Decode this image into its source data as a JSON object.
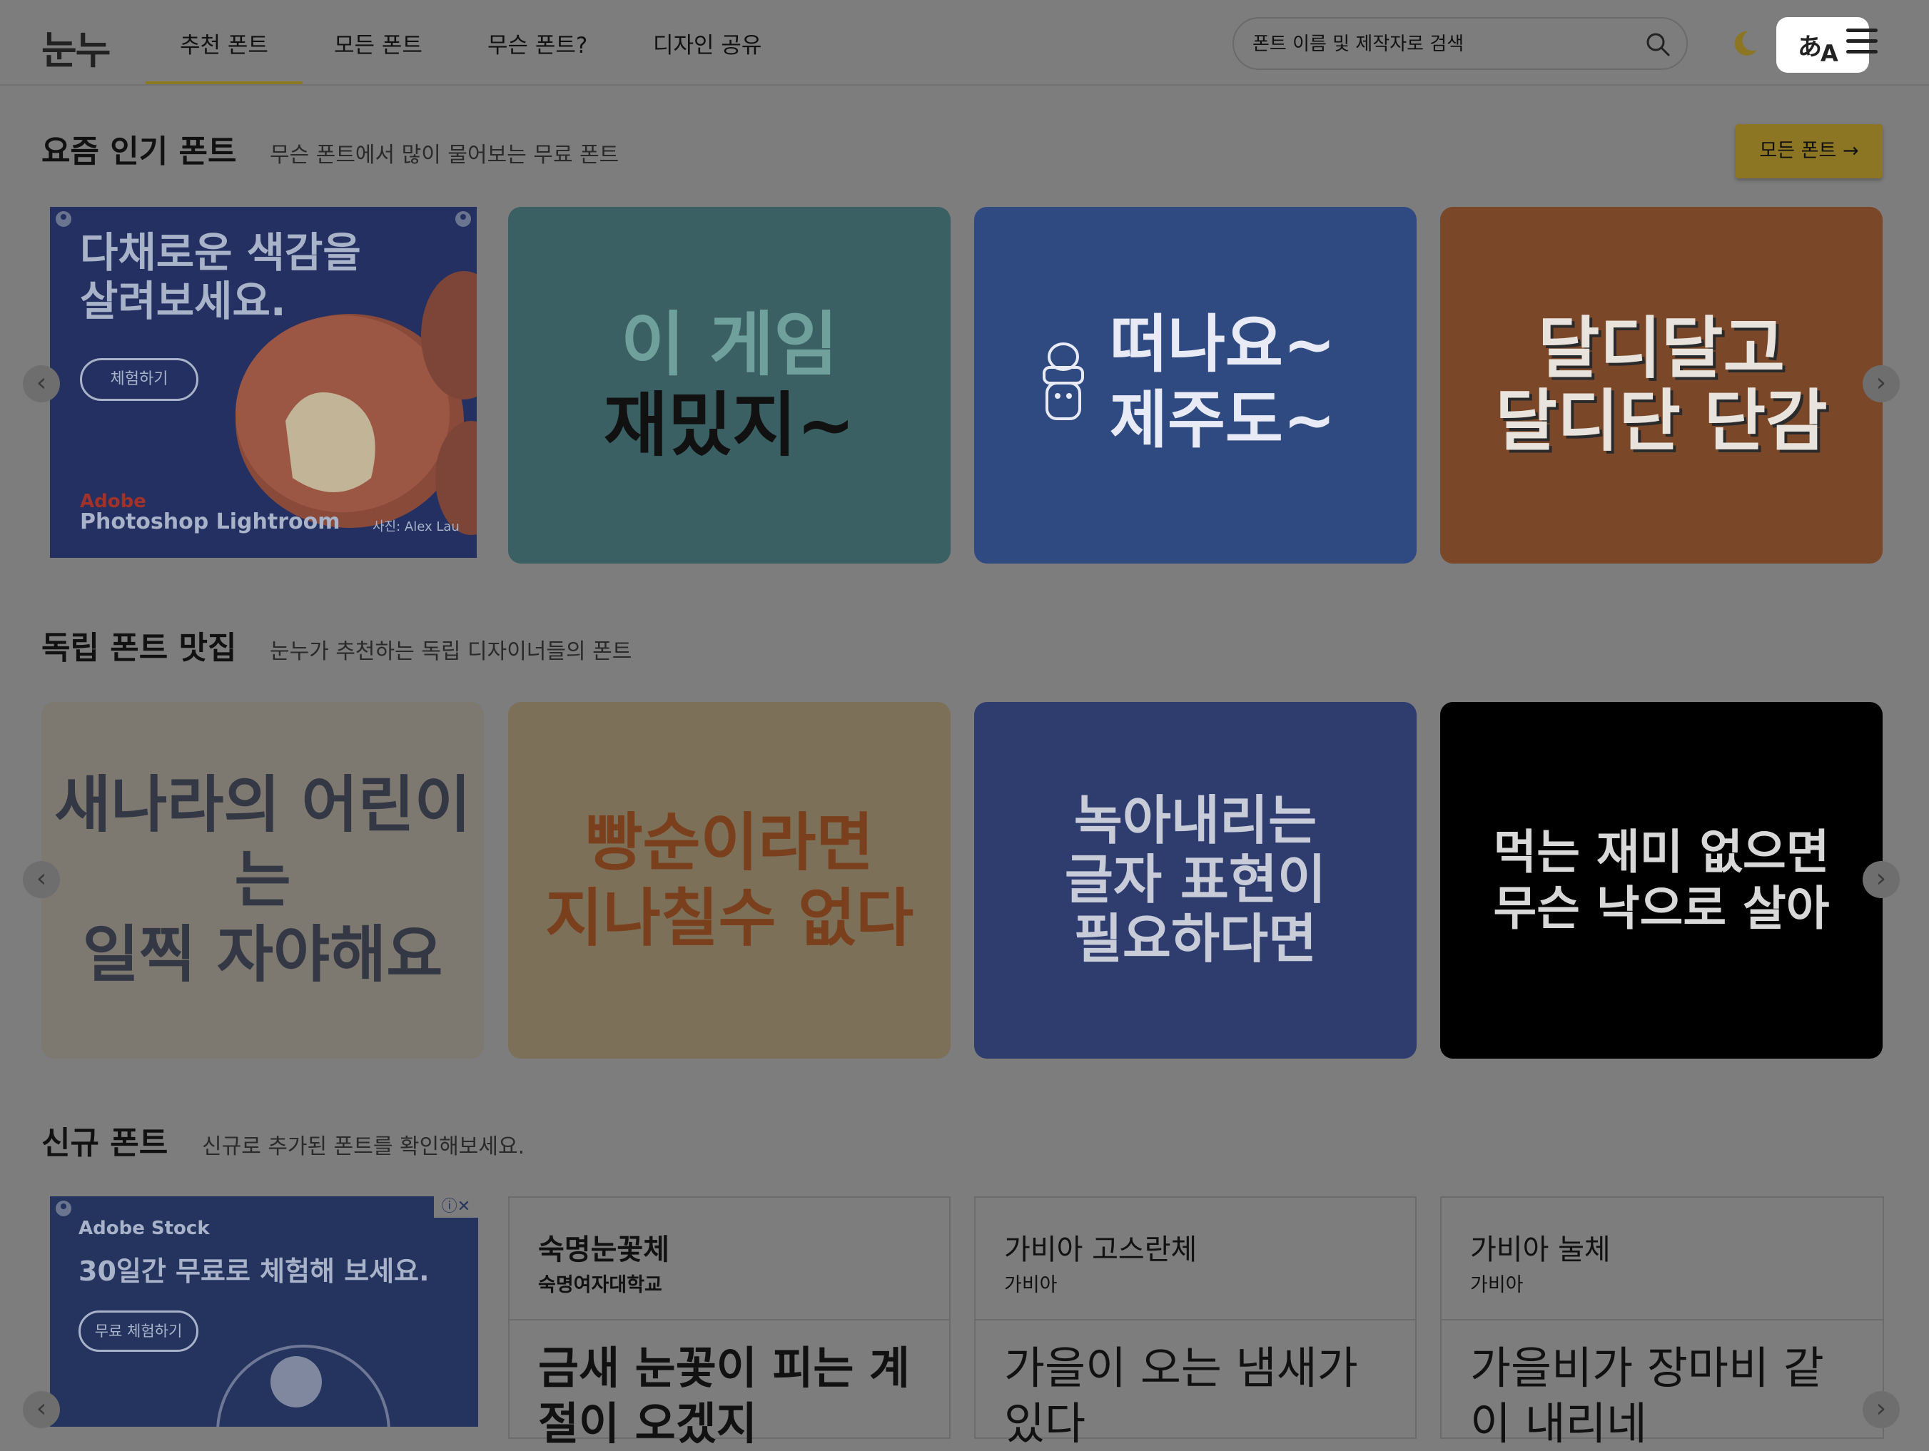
{
  "header": {
    "logo": "눈누",
    "tabs": [
      {
        "label": "추천 폰트",
        "active": true
      },
      {
        "label": "모든 폰트",
        "active": false
      },
      {
        "label": "무슨 폰트?",
        "active": false
      },
      {
        "label": "디자인 공유",
        "active": false
      }
    ],
    "search_placeholder": "폰트 이름 및 제작자로 검색",
    "translate_glyph_1": "あ",
    "translate_glyph_2": "A"
  },
  "popular": {
    "title": "요즘 인기 폰트",
    "subtitle": "무슨 폰트에서 많이 물어보는 무료 폰트",
    "all_button": "모든 폰트 →",
    "ad": {
      "headline_1": "다채로운 색감을",
      "headline_2": "살려보세요.",
      "cta": "체험하기",
      "brand": "Adobe",
      "product": "Photoshop Lightroom",
      "credit": "사진: Alex Lau"
    },
    "cards": [
      {
        "line1": "이 게임",
        "line2": "재밌지~",
        "bg": "#3b6064",
        "color": "#6fa09b"
      },
      {
        "line1": "떠나요~",
        "line2": "제주도~",
        "bg": "#2f4a80",
        "color": "#e8ebf5"
      },
      {
        "line1": "달디달고",
        "line2": "달디단 단감",
        "bg": "#7a4828",
        "color": "#e8e3dc"
      }
    ]
  },
  "indie": {
    "title": "독립 폰트 맛집",
    "subtitle": "눈누가 추천하는 독립 디자이너들의 폰트",
    "cards": [
      {
        "line1": "새나라의 어린이는",
        "line2": "일찍 자야해요",
        "line3": "",
        "bg": "#7d7870",
        "color": "#333844"
      },
      {
        "line1": "빵순이라면",
        "line2": "지나칠수 없다",
        "line3": "",
        "bg": "#7d7058",
        "color": "#7a3f1c"
      },
      {
        "line1": "녹아내리는",
        "line2": "글자 표현이",
        "line3": "필요하다면",
        "bg": "#2e3c6e",
        "color": "#c8ccd8"
      },
      {
        "line1": "먹는 재미 없으면",
        "line2": "무슨 낙으로 살아",
        "line3": "",
        "bg": "#000000",
        "color": "#d8d8d8"
      }
    ]
  },
  "new_fonts": {
    "title": "신규 폰트",
    "subtitle": "신규로 추가된 폰트를 확인해보세요.",
    "ad": {
      "brand": "Adobe Stock",
      "headline": "30일간 무료로 체험해 보세요.",
      "cta": "무료 체험하기"
    },
    "fonts": [
      {
        "name": "숙명눈꽃체",
        "maker": "숙명여자대학교",
        "sample": "금새 눈꽃이 피는 계절이 오겠지"
      },
      {
        "name": "가비아 고스란체",
        "maker": "가비아",
        "sample": "가을이 오는 냄새가 있다"
      },
      {
        "name": "가비아 눌체",
        "maker": "가비아",
        "sample": "가을비가 장마비 같이 내리네"
      }
    ]
  }
}
